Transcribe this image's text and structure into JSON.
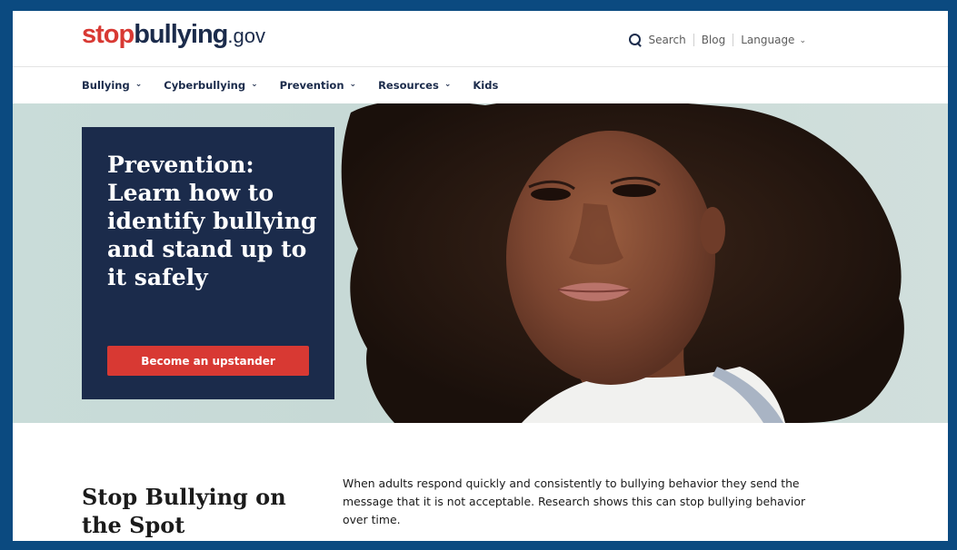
{
  "header": {
    "logo": {
      "stop": "stop",
      "bullying": "bullying",
      "gov": ".gov"
    },
    "utility": {
      "search_label": "Search",
      "blog_label": "Blog",
      "language_label": "Language"
    }
  },
  "nav": {
    "items": [
      {
        "label": "Bullying",
        "has_dropdown": true
      },
      {
        "label": "Cyberbullying",
        "has_dropdown": true
      },
      {
        "label": "Prevention",
        "has_dropdown": true
      },
      {
        "label": "Resources",
        "has_dropdown": true
      },
      {
        "label": "Kids",
        "has_dropdown": false
      }
    ]
  },
  "hero": {
    "title": "Prevention: Learn how to identify bullying and stand up to it safely",
    "button_label": "Become an upstander",
    "image_icon": "portrait-photo"
  },
  "section": {
    "title": "Stop Bullying on the Spot",
    "body": "When adults respond quickly and consistently to bullying behavior they send the message that it is not acceptable. Research shows this can stop bullying behavior over time."
  },
  "colors": {
    "brand_red": "#d83933",
    "brand_navy": "#1b2b4b",
    "frame_blue": "#0b4a80",
    "hero_background": "#c9dcd9"
  }
}
